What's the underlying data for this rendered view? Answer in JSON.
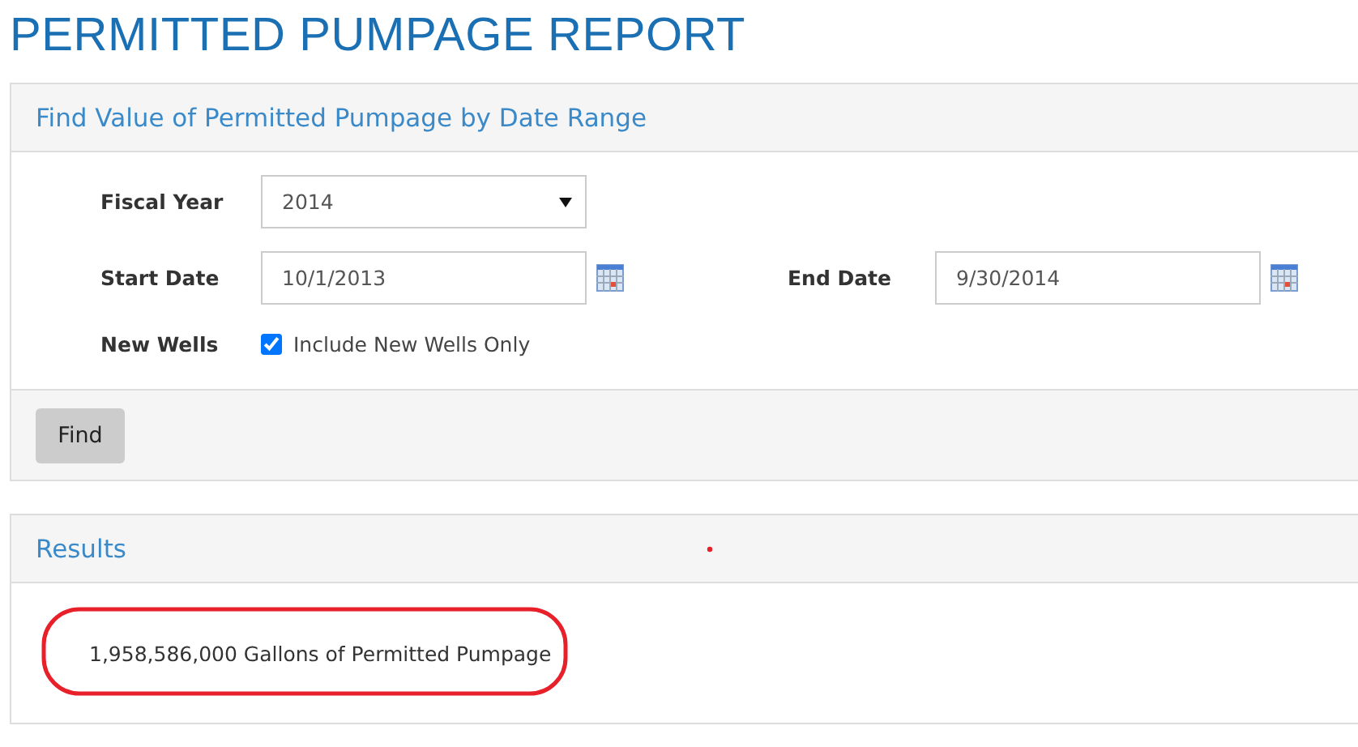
{
  "page_title": "PERMITTED PUMPAGE REPORT",
  "search_panel": {
    "title": "Find Value of Permitted Pumpage by Date Range",
    "fiscal_year": {
      "label": "Fiscal Year",
      "value": "2014"
    },
    "start_date": {
      "label": "Start Date",
      "value": "10/1/2013"
    },
    "end_date": {
      "label": "End Date",
      "value": "9/30/2014"
    },
    "new_wells": {
      "label": "New Wells",
      "option": "Include New Wells Only",
      "checked": true
    },
    "button": "Find"
  },
  "results_panel": {
    "title": "Results",
    "result": "1,958,586,000 Gallons of Permitted Pumpage"
  }
}
